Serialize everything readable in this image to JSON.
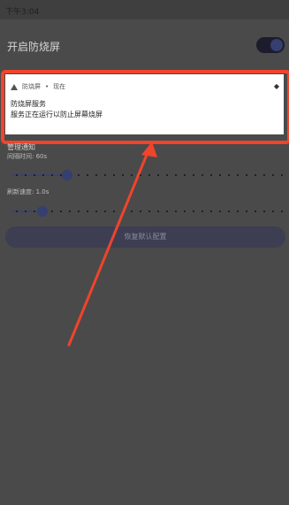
{
  "status_bar": {
    "time": "下午3:04"
  },
  "settings": {
    "enable_label": "开启防烧屏",
    "enabled": true
  },
  "notification": {
    "app_name": "防烧屏",
    "separator": "•",
    "time": "现在",
    "title": "防烧屏服务",
    "body": "服务正在运行以防止屏幕烧屏"
  },
  "sliders": {
    "section_title": "管理通知",
    "interval_label": "间隔时间: 60s",
    "interval_fraction": 0.2,
    "refresh_label": "刷新速度: 1.0s",
    "refresh_fraction": 0.11
  },
  "reset_label": "恢复默认配置",
  "colors": {
    "highlight": "#f0442c",
    "accent": "#353f70"
  }
}
